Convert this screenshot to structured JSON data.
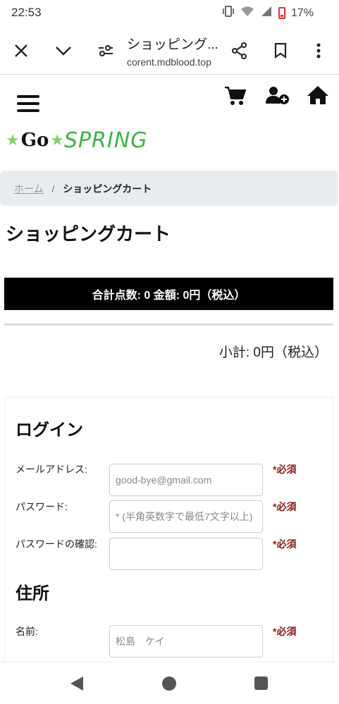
{
  "status": {
    "time": "22:53",
    "battery": "17%"
  },
  "browser": {
    "title": "ショッピング...",
    "url": "corent.mdblood.top"
  },
  "logo": {
    "star": "★",
    "go": "Go",
    "spring": "SPRING"
  },
  "breadcrumb": {
    "home": "ホーム",
    "separator": "/",
    "current": "ショッピングカート"
  },
  "page": {
    "title": "ショッピングカート",
    "summary": "合計点数: 0  金額: 0円（税込）",
    "subtotal": "小計: 0円（税込）"
  },
  "login": {
    "title": "ログイン",
    "email_label": "メールアドレス:",
    "email_placeholder": "good-bye@gmail.com",
    "password_label": "パスワード:",
    "password_placeholder": "* (半角英数字で最低7文字以上)",
    "confirm_label": "パスワードの確認:",
    "confirm_placeholder": ""
  },
  "address": {
    "title": "住所",
    "name_label": "名前:",
    "name_placeholder": "松島　ケイ"
  },
  "required_mark": "*必須",
  "colors": {
    "logo_green": "#3fb34a",
    "required_red": "#8b1a1a",
    "summary_bg": "#000000",
    "breadcrumb_bg": "#e9ecef"
  }
}
